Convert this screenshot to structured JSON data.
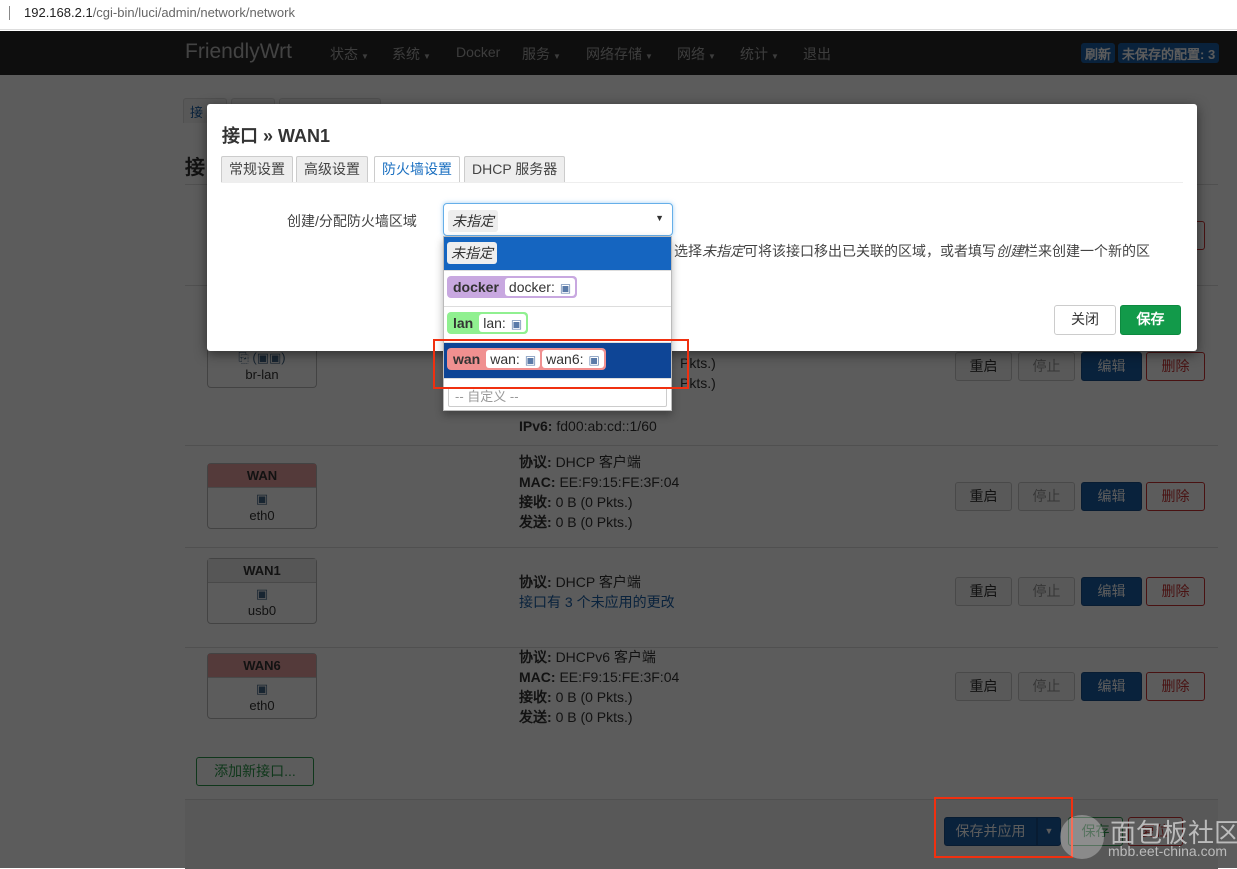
{
  "address_bar": {
    "host": "192.168.2.1",
    "path": "/cgi-bin/luci/admin/network/network"
  },
  "nav": {
    "brand": "FriendlyWrt",
    "items": [
      {
        "label": "状态",
        "dropdown": true
      },
      {
        "label": "系统",
        "dropdown": true
      },
      {
        "label": "Docker",
        "dropdown": false
      },
      {
        "label": "服务",
        "dropdown": true
      },
      {
        "label": "网络存储",
        "dropdown": true
      },
      {
        "label": "网络",
        "dropdown": true
      },
      {
        "label": "统计",
        "dropdown": true
      },
      {
        "label": "退出",
        "dropdown": false
      }
    ],
    "refresh": "刷新",
    "unsaved": "未保存的配置: 3"
  },
  "page": {
    "tab_first": "接",
    "title": "接",
    "rows": [
      {
        "name": "",
        "device": "br-lan",
        "icon": "bridge-icon",
        "info": [
          {
            "k": "",
            "v": "Pkts.)"
          },
          {
            "k": "",
            "v": "Pkts.)"
          },
          {
            "k": "IPv6:",
            "v": "fd00:ab:cd::1/60"
          }
        ]
      },
      {
        "name": "WAN",
        "device": "eth0",
        "icon": "ethernet-icon",
        "info": [
          {
            "k": "协议:",
            "v": "DHCP 客户端"
          },
          {
            "k": "MAC:",
            "v": "EE:F9:15:FE:3F:04"
          },
          {
            "k": "接收:",
            "v": "0 B (0 Pkts.)"
          },
          {
            "k": "发送:",
            "v": "0 B (0 Pkts.)"
          }
        ]
      },
      {
        "name": "WAN1",
        "device": "usb0",
        "icon": "ethernet-icon",
        "info": [
          {
            "k": "协议:",
            "v": "DHCP 客户端"
          }
        ],
        "pending": "接口有 3 个未应用的更改"
      },
      {
        "name": "WAN6",
        "device": "eth0",
        "icon": "ethernet-icon",
        "info": [
          {
            "k": "协议:",
            "v": "DHCPv6 客户端"
          },
          {
            "k": "MAC:",
            "v": "EE:F9:15:FE:3F:04"
          },
          {
            "k": "接收:",
            "v": "0 B (0 Pkts.)"
          },
          {
            "k": "发送:",
            "v": "0 B (0 Pkts.)"
          }
        ]
      }
    ],
    "buttons": {
      "restart": "重启",
      "stop": "停止",
      "edit": "编辑",
      "delete": "删除"
    },
    "add_interface": "添加新接口...",
    "footer": {
      "save_apply": "保存并应用",
      "save": "保存",
      "reset": "复位"
    }
  },
  "modal": {
    "title": "接口 » WAN1",
    "tabs": [
      "常规设置",
      "高级设置",
      "防火墙设置",
      "DHCP 服务器"
    ],
    "active_tab": 2,
    "field_label": "创建/分配防火墙区域",
    "selected": "未指定",
    "hint": {
      "a": "选择",
      "b": "未指定",
      "c": "可将该接口移出已关联的区域，或者填写",
      "d": "创建",
      "e": "栏来创建一个新的区"
    },
    "close": "关闭",
    "save": "保存",
    "options": [
      {
        "label": "未指定"
      },
      {
        "zone": "docker",
        "color": "#c8a8e0",
        "networks": [
          "docker:"
        ]
      },
      {
        "zone": "lan",
        "color": "#90f090",
        "networks": [
          "lan:"
        ]
      },
      {
        "zone": "wan",
        "color": "#f09090",
        "networks": [
          "wan:",
          "wan6:"
        ]
      }
    ],
    "custom_placeholder": "-- 自定义 --"
  },
  "watermark": {
    "name": "面包板社区",
    "url": "mbb.eet-china.com"
  },
  "colors": {
    "highlight": "#1565c0",
    "selected_dark": "#0e4596",
    "annotation": "#f03010"
  }
}
